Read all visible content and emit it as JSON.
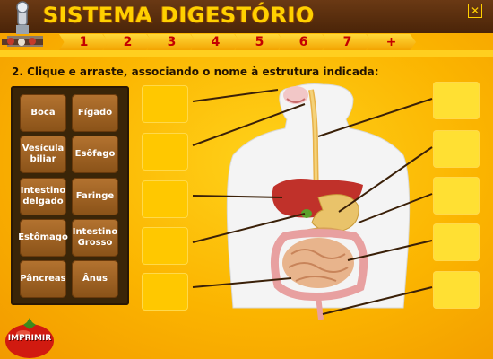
{
  "header": {
    "title": "SISTEMA DIGESTÓRIO",
    "close_symbol": "✕"
  },
  "nav": {
    "tabs": [
      {
        "label": "1"
      },
      {
        "label": "2"
      },
      {
        "label": "3"
      },
      {
        "label": "4"
      },
      {
        "label": "5"
      },
      {
        "label": "6"
      },
      {
        "label": "7"
      },
      {
        "label": "+"
      }
    ]
  },
  "instruction": "2. Clique e arraste, associando o nome à estrutura indicada:",
  "terms": [
    {
      "label": "Boca"
    },
    {
      "label": "Fígado"
    },
    {
      "label": "Vesícula biliar"
    },
    {
      "label": "Esôfago"
    },
    {
      "label": "Intestino delgado"
    },
    {
      "label": "Faringe"
    },
    {
      "label": "Estômago"
    },
    {
      "label": "Intestino Grosso"
    },
    {
      "label": "Pâncreas"
    },
    {
      "label": "Ânus"
    }
  ],
  "print_button": {
    "label": "IMPRIMIR"
  },
  "colors": {
    "header": "#4a2408",
    "title": "#ffd000",
    "tab_text": "#c40000",
    "term_bg": "#9a5e22",
    "slot": "#ffc800"
  }
}
